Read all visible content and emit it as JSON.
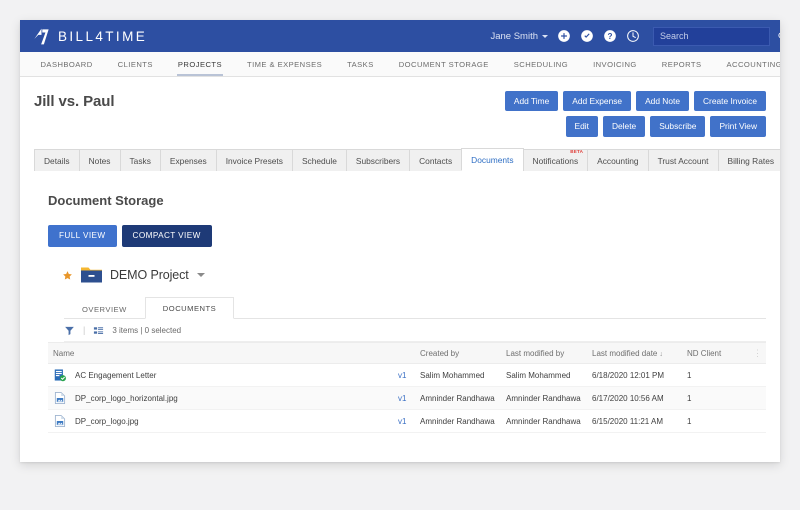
{
  "header": {
    "brand": "BILL4TIME",
    "brand_mark_icon": "bill4time-logo-icon",
    "user_name": "Jane Smith",
    "icons": [
      {
        "name": "add-plus-icon"
      },
      {
        "name": "check-circle-icon"
      },
      {
        "name": "help-question-icon"
      },
      {
        "name": "timer-clock-icon"
      }
    ],
    "search_placeholder": "Search",
    "search_value": "",
    "search_icon": "search-icon"
  },
  "nav": {
    "items": [
      {
        "label": "DASHBOARD",
        "active": false
      },
      {
        "label": "CLIENTS",
        "active": false
      },
      {
        "label": "PROJECTS",
        "active": true
      },
      {
        "label": "TIME & EXPENSES",
        "active": false
      },
      {
        "label": "TASKS",
        "active": false
      },
      {
        "label": "DOCUMENT STORAGE",
        "active": false
      },
      {
        "label": "SCHEDULING",
        "active": false
      },
      {
        "label": "INVOICING",
        "active": false
      },
      {
        "label": "REPORTS",
        "active": false
      },
      {
        "label": "ACCOUNTING",
        "active": false
      }
    ]
  },
  "page": {
    "title": "Jill vs. Paul",
    "actions_row1": [
      "Add Time",
      "Add Expense",
      "Add Note",
      "Create Invoice"
    ],
    "actions_row2": [
      "Edit",
      "Delete",
      "Subscribe",
      "Print View"
    ]
  },
  "project_tabs": [
    {
      "label": "Details",
      "active": false
    },
    {
      "label": "Notes",
      "active": false
    },
    {
      "label": "Tasks",
      "active": false
    },
    {
      "label": "Expenses",
      "active": false
    },
    {
      "label": "Invoice Presets",
      "active": false
    },
    {
      "label": "Schedule",
      "active": false
    },
    {
      "label": "Subscribers",
      "active": false
    },
    {
      "label": "Contacts",
      "active": false
    },
    {
      "label": "Documents",
      "active": true
    },
    {
      "label": "Notifications",
      "active": false,
      "badge": "BETA"
    },
    {
      "label": "Accounting",
      "active": false
    },
    {
      "label": "Trust Account",
      "active": false
    },
    {
      "label": "Billing Rates",
      "active": false
    }
  ],
  "document_storage": {
    "heading": "Document Storage",
    "view_buttons": [
      {
        "label": "FULL VIEW",
        "style": "primary"
      },
      {
        "label": "COMPACT VIEW",
        "style": "dark"
      }
    ],
    "folder": {
      "star_icon": "star-favorite-icon",
      "folder_icon": "folder-icon",
      "name": "DEMO Project",
      "caret_icon": "chevron-down-icon"
    },
    "sub_tabs": [
      {
        "label": "OVERVIEW",
        "active": false
      },
      {
        "label": "DOCUMENTS",
        "active": true
      }
    ],
    "toolbar": {
      "filter_icon": "filter-funnel-icon",
      "separator": "|",
      "view_icon": "list-view-icon",
      "status": "3 items  |  0 selected"
    },
    "table": {
      "columns": {
        "name": "Name",
        "version": "",
        "created_by": "Created by",
        "last_modified_by": "Last modified by",
        "last_modified_date": "Last modified date",
        "sort_arrow": "↓",
        "nd_client": "ND Client",
        "kebab": "⋮"
      },
      "rows": [
        {
          "icon": "word-document-approved-icon",
          "name": "AC Engagement Letter",
          "version": "v1",
          "created_by": "Salim Mohammed",
          "last_modified_by": "Salim Mohammed",
          "last_modified_date": "6/18/2020 12:01 PM",
          "nd_client": "1"
        },
        {
          "icon": "image-file-icon",
          "name": "DP_corp_logo_horizontal.jpg",
          "version": "v1",
          "created_by": "Amninder Randhawa",
          "last_modified_by": "Amninder Randhawa",
          "last_modified_date": "6/17/2020 10:56 AM",
          "nd_client": "1"
        },
        {
          "icon": "image-file-icon",
          "name": "DP_corp_logo.jpg",
          "version": "v1",
          "created_by": "Amninder Randhawa",
          "last_modified_by": "Amninder Randhawa",
          "last_modified_date": "6/15/2020 11:21 AM",
          "nd_client": "1"
        }
      ]
    }
  },
  "colors": {
    "header_blue": "#2d4fa2",
    "button_blue": "#4172c9",
    "dark_navy": "#1e3a77",
    "link_blue": "#3a6fc4",
    "beta_red": "#e0413c",
    "star_orange": "#e8962a",
    "folder_yellow": "#f5b731"
  }
}
